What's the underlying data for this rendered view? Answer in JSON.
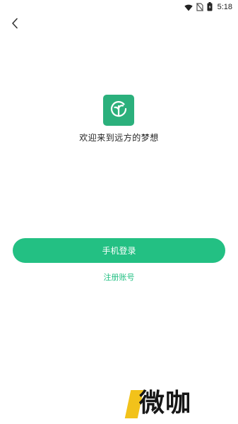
{
  "status_bar": {
    "time": "5:18",
    "icons": [
      "wifi-icon",
      "no-sim-icon",
      "battery-icon"
    ]
  },
  "header": {
    "back_icon": "chevron-left-icon"
  },
  "brand": {
    "logo_icon": "sprout-logo-icon",
    "welcome": "欢迎来到远方的梦想"
  },
  "actions": {
    "phone_login": "手机登录",
    "register": "注册账号"
  },
  "watermark": {
    "text": "微咖"
  },
  "colors": {
    "accent": "#23c083",
    "logo_bg": "#2bb07c",
    "watermark_stripe": "#f2c21a"
  }
}
